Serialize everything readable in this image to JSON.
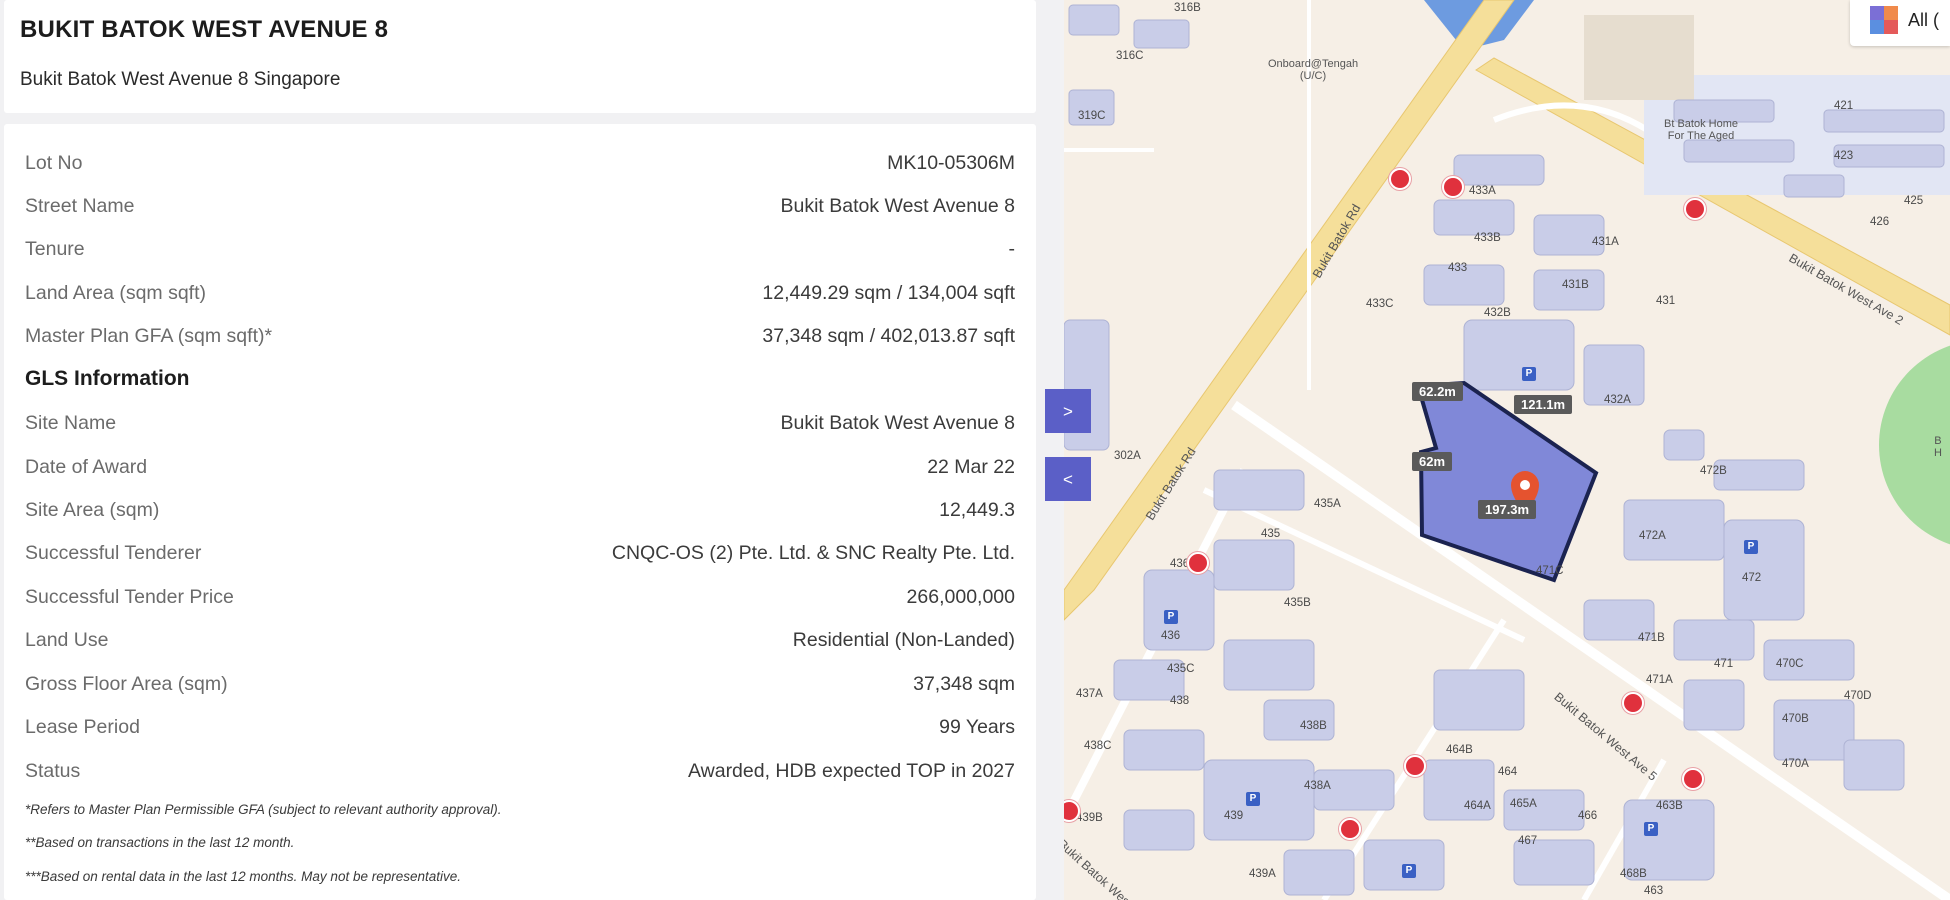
{
  "header": {
    "title": "BUKIT BATOK WEST AVENUE 8",
    "subtitle": "Bukit Batok West Avenue 8 Singapore"
  },
  "details": [
    {
      "label": "Lot No",
      "value": "MK10-05306M"
    },
    {
      "label": "Street Name",
      "value": "Bukit Batok West Avenue 8"
    },
    {
      "label": "Tenure",
      "value": "-"
    },
    {
      "label": "Land Area (sqm sqft)",
      "value": "12,449.29 sqm / 134,004 sqft"
    },
    {
      "label": "Master Plan GFA (sqm sqft)*",
      "value": "37,348 sqm / 402,013.87 sqft"
    }
  ],
  "gls": {
    "heading": "GLS Information",
    "rows": [
      {
        "label": "Site Name",
        "value": "Bukit Batok West Avenue 8"
      },
      {
        "label": "Date of Award",
        "value": "22 Mar 22"
      },
      {
        "label": "Site Area (sqm)",
        "value": "12,449.3"
      },
      {
        "label": "Successful Tenderer",
        "value": "CNQC-OS (2) Pte. Ltd. & SNC Realty Pte. Ltd."
      },
      {
        "label": "Successful Tender Price",
        "value": "266,000,000"
      },
      {
        "label": "Land Use",
        "value": "Residential (Non-Landed)"
      },
      {
        "label": "Gross Floor Area (sqm)",
        "value": "37,348 sqm"
      },
      {
        "label": "Lease Period",
        "value": "99 Years"
      },
      {
        "label": "Status",
        "value": "Awarded, HDB expected TOP in 2027"
      }
    ]
  },
  "notes": [
    "*Refers to Master Plan Permissible GFA (subject to relevant authority approval).",
    "**Based on transactions in the last 12 month.",
    "***Based on rental data in the last 12 months. May not be representative."
  ],
  "map": {
    "legend_label": "All (",
    "expand_label": ">",
    "collapse_label": "<",
    "places": {
      "onboard": "Onboard@Tengah",
      "onboard_status": "(U/C)",
      "home_line1": "Bt Batok Home",
      "home_line2": "For The Aged",
      "park_line1": "B",
      "park_line2": "H"
    },
    "roads": {
      "bukit_batok_rd_1": "Bukit Batok Rd",
      "bukit_batok_rd_2": "Bukit Batok Rd",
      "west_ave_2": "Bukit Batok West Ave 2",
      "west_ave_5": "Bukit Batok West Ave 5",
      "west_ave_bottom": "Bukit Batok West Ave"
    },
    "measurements": {
      "top": "62.2m",
      "right": "121.1m",
      "left": "62m",
      "bottom": "197.3m"
    },
    "parking_symbol": "P",
    "blocks": [
      "316B",
      "316C",
      "319C",
      "421",
      "423",
      "425",
      "426",
      "433A",
      "433B",
      "431A",
      "433",
      "431B",
      "433C",
      "431",
      "432B",
      "432A",
      "472B",
      "302A",
      "435A",
      "435",
      "436A",
      "435B",
      "472A",
      "471C",
      "472",
      "436",
      "471B",
      "470C",
      "471",
      "470D",
      "471A",
      "435C",
      "437A",
      "438",
      "470B",
      "438B",
      "438C",
      "464B",
      "470A",
      "438A",
      "464",
      "439B",
      "439",
      "464A",
      "465A",
      "466",
      "463B",
      "467",
      "468B",
      "439A",
      "463"
    ],
    "colors": {
      "site_fill": "#8088d8",
      "site_border": "#1b2350",
      "building": "#c9cde8",
      "road": "#f5df9a",
      "park": "#a8dca0",
      "accent": "#5b5fc7"
    }
  }
}
